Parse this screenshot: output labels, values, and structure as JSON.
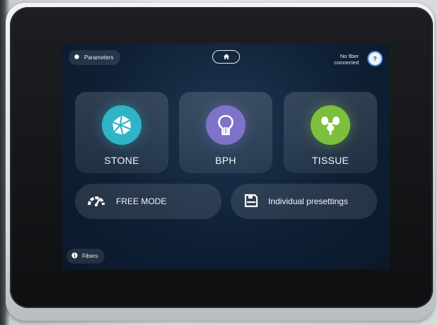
{
  "header": {
    "parameters_label": "Parameters",
    "fiber_status_line1": "No fiber",
    "fiber_status_line2": "connected",
    "help_label": "?"
  },
  "modes": [
    {
      "label": "STONE",
      "icon": "stone-icon",
      "color": "#2fb4c6"
    },
    {
      "label": "BPH",
      "icon": "prostate-icon",
      "color": "#7f73c9"
    },
    {
      "label": "TISSUE",
      "icon": "tissue-icon",
      "color": "#7cbf3c"
    }
  ],
  "actions": {
    "free_mode_label": "FREE MODE",
    "presettings_label": "Individual presettings"
  },
  "footer": {
    "fibers_label": "Fibers"
  },
  "colors": {
    "screen_background": "#0f2036",
    "help_ring": "#3f86d8"
  }
}
